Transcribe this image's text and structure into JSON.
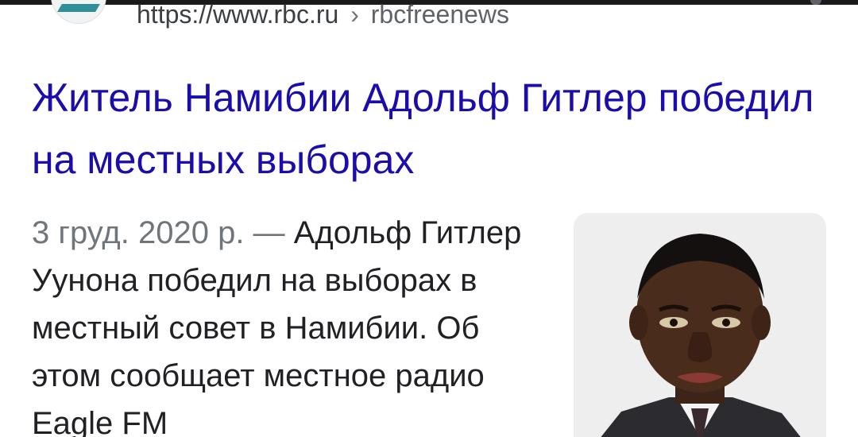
{
  "result": {
    "url_base": "https://www.rbc.ru",
    "breadcrumb_separator": "›",
    "url_path": "rbcfreenews",
    "title": "Житель Намибии Адольф Гитлер победил на местных выборах",
    "date": "3 груд. 2020 р.",
    "date_separator": " — ",
    "snippet": "Адольф Гитлер Уунона победил на выборах в местный совет в Намибии. Об этом сообщает местное радио Eagle FM"
  },
  "colors": {
    "title_link": "#1a0dab",
    "snippet_text": "#202124",
    "date_text": "#70757a",
    "url_text": "#3c4043"
  },
  "icons": {
    "favicon": "site-favicon-icon",
    "menu": "more-options-icon"
  }
}
